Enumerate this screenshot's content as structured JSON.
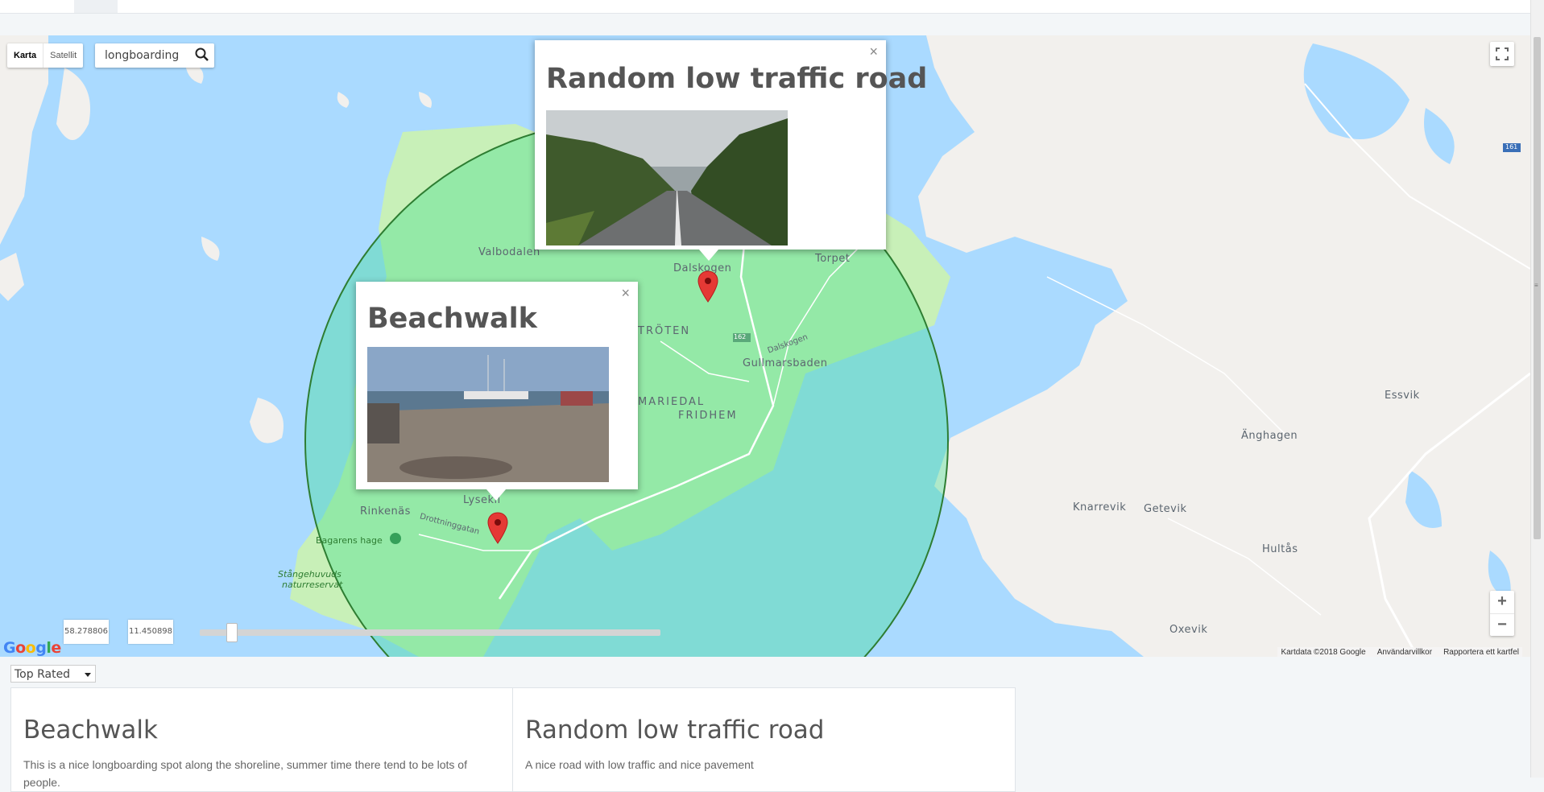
{
  "map": {
    "map_type_buttons": [
      "Karta",
      "Satellit"
    ],
    "search_value": "longboarding",
    "places": {
      "valbodalen": "Valbodalen",
      "dalskogen": "Dalskogen",
      "torpet": "Torpet",
      "troten": "TRÖTEN",
      "gullmarsbaden": "Gullmarsbaden",
      "mariedal": "MARIEDAL",
      "fridhem": "FRIDHEM",
      "lysekil": "Lysekil",
      "rinkenas": "Rinkenäs",
      "bagarens_hage": "Bagarens hage",
      "drottninggatan": "Drottninggatan",
      "dalskogen_road": "Dalskogen",
      "stangehuvud": "Stångehuvuds",
      "naturreservat": "naturreservat",
      "essvik": "Essvik",
      "anghagen": "Änghagen",
      "knarrevik": "Knarrevik",
      "getevik": "Getevik",
      "hultas": "Hultås",
      "oxevik": "Oxevik",
      "road_162": "162",
      "road_161": "161"
    },
    "coordinates": {
      "lat": "58.278806",
      "lng": "11.450898"
    },
    "radius_slider_value": 0.06,
    "attribution": [
      "Kartdata ©2018 Google",
      "Användarvillkor",
      "Rapportera ett kartfel"
    ],
    "logo": "Google",
    "zoom_in": "+",
    "zoom_out": "−",
    "info_windows": [
      {
        "title": "Random low traffic road",
        "close": "×"
      },
      {
        "title": "Beachwalk",
        "close": "×"
      }
    ]
  },
  "sort": {
    "selected": "Top Rated"
  },
  "spots": [
    {
      "title": "Beachwalk",
      "description": "This is a nice longboarding spot along the shoreline, summer time there tend to be lots of people."
    },
    {
      "title": "Random low traffic road",
      "description": "A nice road with low traffic and nice pavement"
    }
  ],
  "colors": {
    "water": "#aadaff",
    "land": "#f2f0ed",
    "radius": "#8ee6a0",
    "pin": "#e53935"
  }
}
